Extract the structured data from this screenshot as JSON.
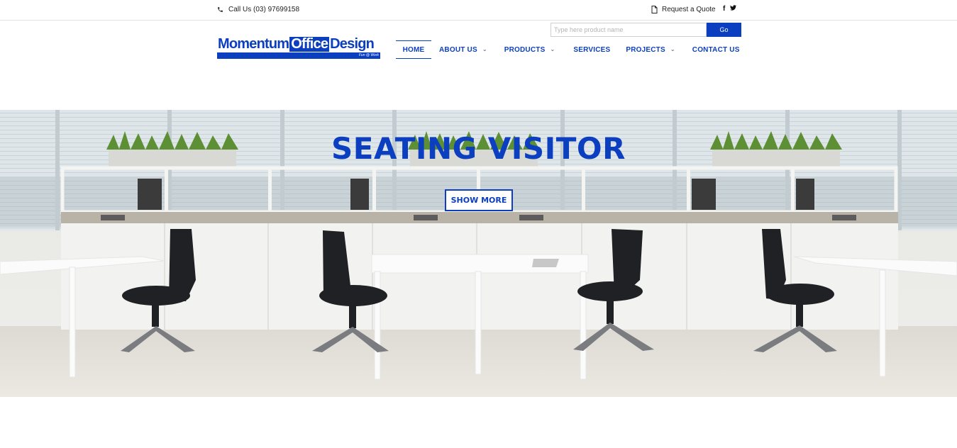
{
  "topbar": {
    "phone_icon": "phone-icon",
    "call_label": "Call Us (03) 97699158",
    "quote_icon": "document-icon",
    "quote_label": "Request a Quote",
    "social": {
      "facebook": "f",
      "twitter": "𝕥"
    }
  },
  "header": {
    "logo": {
      "word1": "Momentum",
      "word2": "Office",
      "word3": "Design",
      "tagline": "Fun @ Work"
    },
    "search": {
      "placeholder": "Type here product name",
      "value": "",
      "button_label": "Go"
    },
    "nav": [
      {
        "label": "HOME",
        "active": true,
        "dropdown": false
      },
      {
        "label": "ABOUT US",
        "active": false,
        "dropdown": true
      },
      {
        "label": "PRODUCTS",
        "active": false,
        "dropdown": true
      },
      {
        "label": "SERVICES",
        "active": false,
        "dropdown": false
      },
      {
        "label": "PROJECTS",
        "active": false,
        "dropdown": true
      },
      {
        "label": "CONTACT US",
        "active": false,
        "dropdown": false
      }
    ]
  },
  "hero": {
    "title": "SEATING VISITOR",
    "button_label": "SHOW MORE"
  },
  "colors": {
    "brand": "#0b3fbf",
    "text": "#222222",
    "border": "#e3e3e3"
  }
}
